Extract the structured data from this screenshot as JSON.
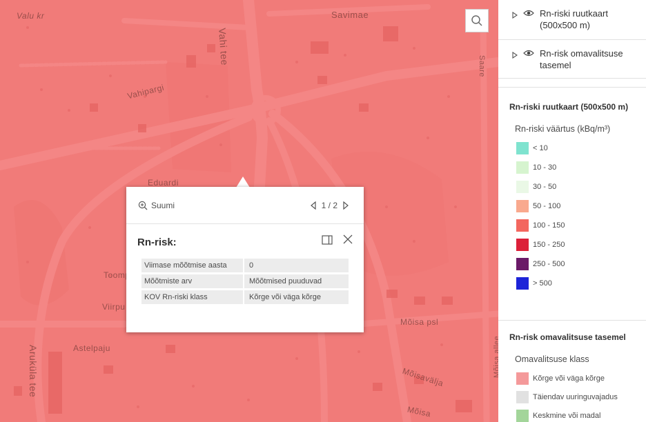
{
  "map": {
    "overlay_color": "#f06262",
    "street_labels": [
      "Vahi tee",
      "Savimae",
      "Vahipargi",
      "Eduardi",
      "Toompi",
      "Viirpu",
      "Astelpaju",
      "Aruküla tee",
      "Mõisa psl",
      "Mõisavälja",
      "Mõisa allee",
      "Saare",
      "Valu kr",
      "Mõisa"
    ],
    "search_icon": "search-icon"
  },
  "popup": {
    "zoom_label": "Suumi",
    "pager": "1 / 2",
    "title": "Rn-risk:",
    "icons": {
      "zoom": "zoom-in-icon",
      "prev": "triangle-left-icon",
      "next": "triangle-right-icon",
      "dock": "dock-icon",
      "close": "close-icon"
    },
    "rows": [
      {
        "key": "Viimase mõõtmise aasta",
        "value": "0"
      },
      {
        "key": "Mõõtmiste arv",
        "value": "Mõõtmised puuduvad"
      },
      {
        "key": "KOV Rn-riski klass",
        "value": "Kõrge või väga kõrge"
      }
    ]
  },
  "layers": [
    {
      "label": "Rn-riski ruutkaart (500x500 m)"
    },
    {
      "label": "Rn-risk omavalitsuse tasemel"
    }
  ],
  "legend1": {
    "heading": "Rn-riski ruutkaart (500x500 m)",
    "subtitle": "Rn-riski väärtus (kBq/m³)",
    "items": [
      {
        "label": "< 10",
        "color": "#7fe3cf"
      },
      {
        "label": "10 - 30",
        "color": "#d6f4cf"
      },
      {
        "label": "30 - 50",
        "color": "#eaf8e6"
      },
      {
        "label": "50 - 100",
        "color": "#f9a98e"
      },
      {
        "label": "100 - 150",
        "color": "#f3675f"
      },
      {
        "label": "150 - 250",
        "color": "#dc2039"
      },
      {
        "label": "250 - 500",
        "color": "#6b1a68"
      },
      {
        "label": "> 500",
        "color": "#1d24d8"
      }
    ]
  },
  "legend2": {
    "heading": "Rn-risk omavalitsuse tasemel",
    "subtitle": "Omavalitsuse klass",
    "items": [
      {
        "label": "Kõrge või väga kõrge",
        "color": "#f4999a"
      },
      {
        "label": "Täiendav uuringuvajadus",
        "color": "#e1e1e1"
      },
      {
        "label": "Keskmine või madal",
        "color": "#a3d59a"
      }
    ]
  }
}
